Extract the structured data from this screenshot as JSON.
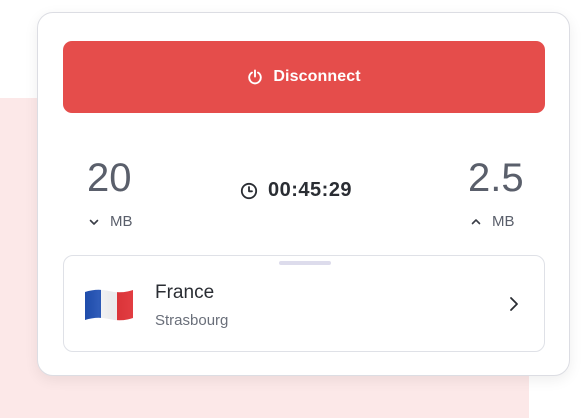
{
  "disconnect": {
    "label": "Disconnect",
    "icon": "power-icon",
    "color": "#e54d4b"
  },
  "stats": {
    "download": {
      "value": "20",
      "unit": "MB",
      "icon": "chevron-down-icon"
    },
    "upload": {
      "value": "2.5",
      "unit": "MB",
      "icon": "chevron-up-icon"
    }
  },
  "timer": {
    "value": "00:45:29",
    "icon": "clock-icon"
  },
  "location": {
    "country": "France",
    "city": "Strasbourg",
    "flag": "france-flag",
    "icon": "chevron-right-icon"
  },
  "colors": {
    "accent": "#e54d4b",
    "background_tint": "#fce8e8"
  }
}
